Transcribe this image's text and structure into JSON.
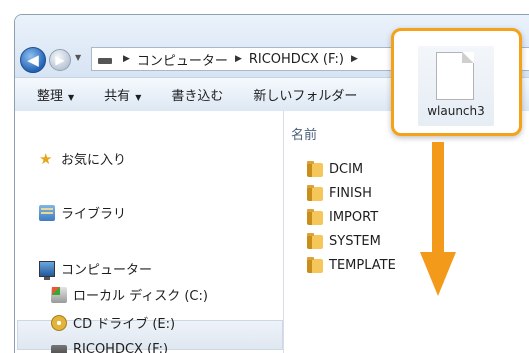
{
  "address": {
    "crumbs": [
      "コンピューター",
      "RICOHDCX (F:)"
    ]
  },
  "toolbar": {
    "organize": "整理",
    "share": "共有",
    "burn": "書き込む",
    "new_folder": "新しいフォルダー"
  },
  "sidebar": {
    "favorites": "お気に入り",
    "libraries": "ライブラリ",
    "computer": "コンピューター",
    "local_disk": "ローカル ディスク (C:)",
    "cd_drive": "CD ドライブ (E:)",
    "ricoh_drive": "RICOHDCX (F:)"
  },
  "content": {
    "column_name": "名前",
    "folders": [
      "DCIM",
      "FINISH",
      "IMPORT",
      "SYSTEM",
      "TEMPLATE"
    ]
  },
  "callout": {
    "file_name": "wlaunch3",
    "accent_color": "#f4a21a"
  },
  "arrow_color": "#f49a1a"
}
